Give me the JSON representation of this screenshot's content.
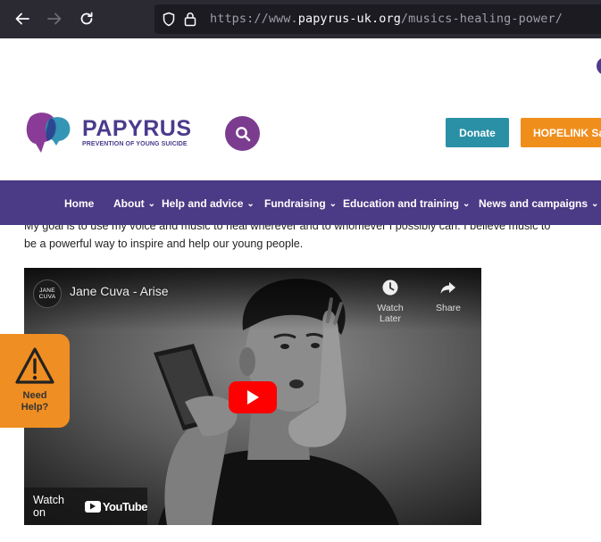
{
  "browser": {
    "url_prefix": "https://www.",
    "url_host": "papyrus-uk.org",
    "url_path": "/musics-healing-power/"
  },
  "header": {
    "logo_name": "PAPYRUS",
    "logo_tagline": "PREVENTION OF YOUNG SUICIDE",
    "donate_label": "Donate",
    "hopelink_label": "HOPELINK Sa",
    "colors": {
      "brand_purple": "#4b3b8c",
      "donate": "#2a90a6",
      "hopelink": "#f08e1c",
      "search": "#7b3c8f"
    }
  },
  "nav": {
    "items": [
      {
        "label": "Home",
        "has_dropdown": false
      },
      {
        "label": "About",
        "has_dropdown": true
      },
      {
        "label": "Help and advice",
        "has_dropdown": true
      },
      {
        "label": "Fundraising",
        "has_dropdown": true
      },
      {
        "label": "Education and training",
        "has_dropdown": true
      },
      {
        "label": "News and campaigns",
        "has_dropdown": true
      }
    ],
    "chevron": "⌄"
  },
  "content": {
    "para_line1": "My goal is to use my voice and music to heal wherever and to whomever I possibly can. I believe music to",
    "para_line2": "be a powerful way to inspire and help our young people."
  },
  "video": {
    "channel_avatar_text": "JANE CUVA",
    "title": "Jane Cuva - Arise",
    "watch_later_label": "Watch Later",
    "share_label": "Share",
    "watch_on_label": "Watch on",
    "youtube_label": "YouTube"
  },
  "help_tab": {
    "line1": "Need",
    "line2": "Help?"
  }
}
